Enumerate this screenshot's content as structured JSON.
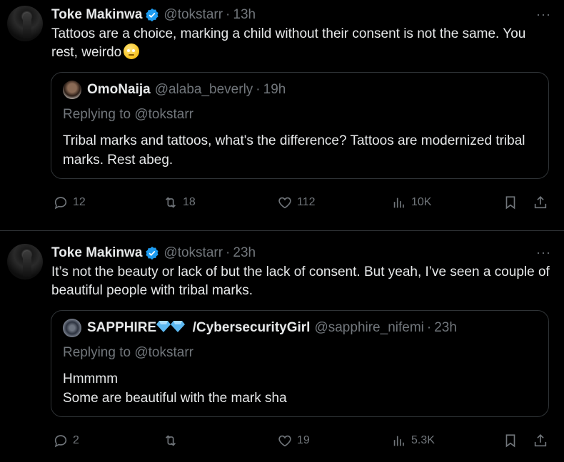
{
  "tweets": [
    {
      "author_name": "Toke Makinwa",
      "handle": "@tokstarr",
      "separator": "·",
      "time": "13h",
      "text": "Tattoos are a choice, marking a child without their consent is not the same. You rest, weirdo",
      "more_icon": "···",
      "quote": {
        "author_name": "OmoNaija",
        "handle": "@alaba_beverly",
        "separator": "·",
        "time": "19h",
        "replying": "Replying to @tokstarr",
        "text": "Tribal marks and tattoos, what's the difference? Tattoos are modernized tribal marks. Rest abeg."
      },
      "actions": {
        "replies": "12",
        "reposts": "18",
        "likes": "112",
        "views": "10K"
      }
    },
    {
      "author_name": "Toke Makinwa",
      "handle": "@tokstarr",
      "separator": "·",
      "time": "23h",
      "text": "It’s not the beauty or lack of but the lack of consent. But yeah, I’ve seen a couple of beautiful people with tribal marks.",
      "more_icon": "···",
      "quote": {
        "author_name_part1": "SAPPHIRE",
        "author_name_part2": "/CybersecurityGirl",
        "handle": "@sapphire_nifemi",
        "separator": "·",
        "time": "23h",
        "replying": "Replying to @tokstarr",
        "text_line1": "Hmmmm",
        "text_line2": "Some are beautiful with the mark sha"
      },
      "actions": {
        "replies": "2",
        "reposts": "",
        "likes": "19",
        "views": "5.3K"
      }
    }
  ],
  "colors": {
    "background": "#000000",
    "text": "#e7e9ea",
    "secondary": "#71767b",
    "border": "#2f3336",
    "verified": "#1d9bf0"
  }
}
